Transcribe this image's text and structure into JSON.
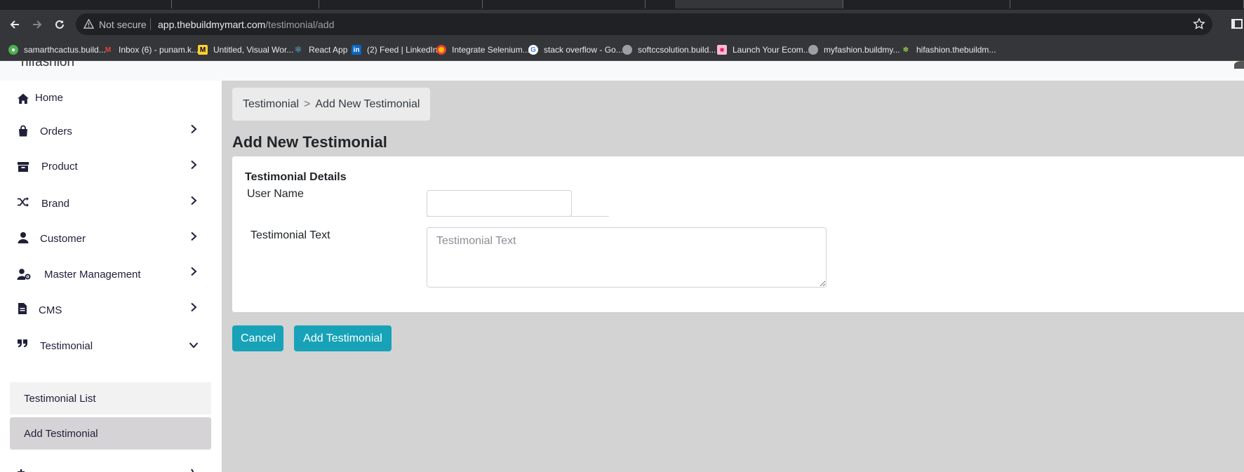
{
  "browser": {
    "security_label": "Not secure",
    "url_host": "app.thebuildmymart.com",
    "url_path": "/testimonial/add",
    "bookmarks": [
      {
        "label": "samarthcactus.build...",
        "icon": "cactus-favicon",
        "color": "#4caf50"
      },
      {
        "label": "Inbox (6) - punam.k...",
        "icon": "gmail-icon",
        "color": "#ea4335"
      },
      {
        "label": "Untitled, Visual Wor...",
        "icon": "miro-icon",
        "color": "#ffd02f"
      },
      {
        "label": "React App",
        "icon": "react-icon",
        "color": "#61dafb"
      },
      {
        "label": "(2) Feed | LinkedIn",
        "icon": "linkedin-icon",
        "color": "#0a66c2"
      },
      {
        "label": "Integrate Selenium...",
        "icon": "chrome-favicon",
        "color": "#fbbc05"
      },
      {
        "label": "stack overflow - Go...",
        "icon": "google-icon",
        "color": "#4285f4"
      },
      {
        "label": "softccsolution.build...",
        "icon": "globe-icon",
        "color": "#9aa0a6"
      },
      {
        "label": "Launch Your Ecom...",
        "icon": "store-favicon",
        "color": "#e91e63"
      },
      {
        "label": "myfashion.buildmy...",
        "icon": "globe-icon",
        "color": "#9aa0a6"
      },
      {
        "label": "hifashion.thebuildm...",
        "icon": "plant-favicon",
        "color": "#8bc34a"
      }
    ]
  },
  "app": {
    "brand": "hifashion"
  },
  "sidebar": {
    "items": [
      {
        "label": "Home",
        "icon": "home-icon"
      },
      {
        "label": "Orders",
        "icon": "shopping-bag-icon"
      },
      {
        "label": "Product",
        "icon": "archive-icon"
      },
      {
        "label": "Brand",
        "icon": "random-icon"
      },
      {
        "label": "Customer",
        "icon": "user-icon"
      },
      {
        "label": "Master Management",
        "icon": "user-gear-icon"
      },
      {
        "label": "CMS",
        "icon": "file-icon"
      },
      {
        "label": "Testimonial",
        "icon": "quote-icon"
      }
    ],
    "testimonial_sub": [
      {
        "label": "Testimonial List"
      },
      {
        "label": "Add Testimonial"
      }
    ]
  },
  "breadcrumb": {
    "parent": "Testimonial",
    "separator": ">",
    "current": "Add New Testimonial"
  },
  "page": {
    "title": "Add New Testimonial"
  },
  "form": {
    "section_title": "Testimonial Details",
    "user_name_label": "User Name",
    "user_name_value": "",
    "testimonial_text_label": "Testimonial Text",
    "testimonial_text_placeholder": "Testimonial Text"
  },
  "actions": {
    "cancel_label": "Cancel",
    "submit_label": "Add Testimonial"
  },
  "colors": {
    "accent": "#17a2b8",
    "content_bg": "#d3d3d3",
    "sidebar_bg": "#ffffff",
    "active_sub_bg": "#d6d3d6",
    "sub_bg": "#f2f2f2",
    "nav_text": "#1f1f3a"
  }
}
